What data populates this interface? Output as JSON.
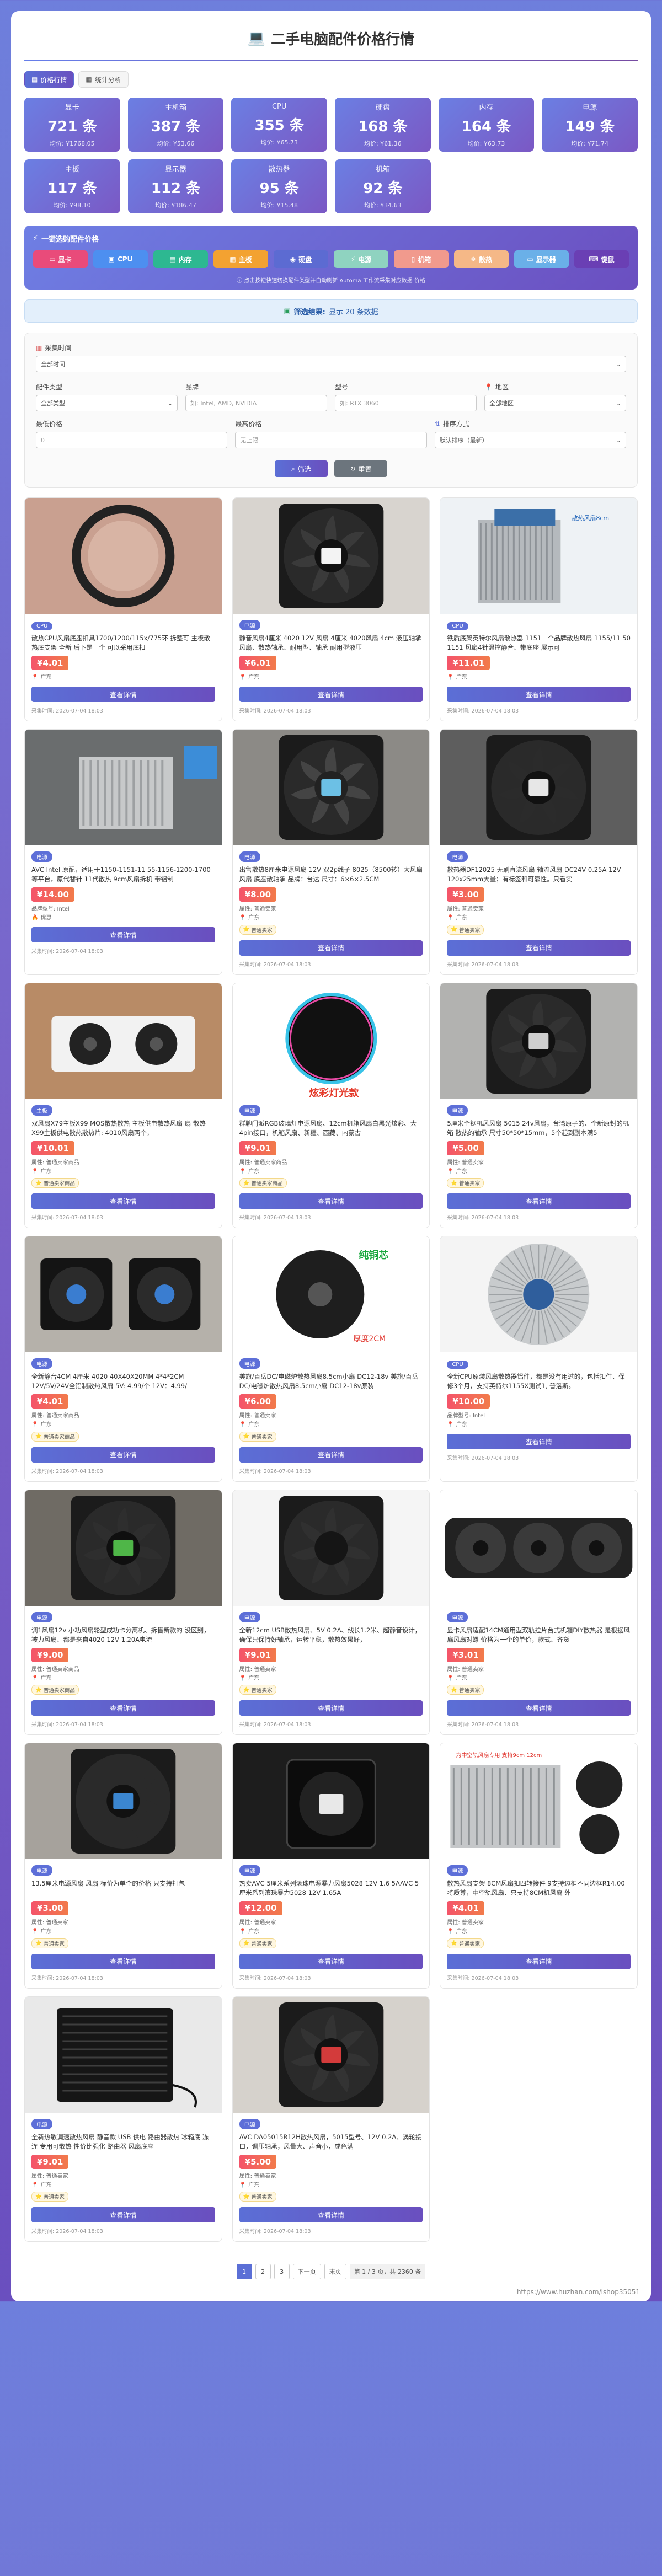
{
  "header": {
    "icon": "monitor-icon",
    "title": "二手电脑配件价格行情"
  },
  "tabs": [
    {
      "label": "价格行情",
      "icon": "price-icon",
      "active": true
    },
    {
      "label": "统计分析",
      "icon": "chart-icon",
      "active": false
    }
  ],
  "stats": [
    {
      "name": "显卡",
      "count": "721 条",
      "avg": "均价: ¥1768.05"
    },
    {
      "name": "主机箱",
      "count": "387 条",
      "avg": "均价: ¥53.66"
    },
    {
      "name": "CPU",
      "count": "355 条",
      "avg": "均价: ¥65.73"
    },
    {
      "name": "硬盘",
      "count": "168 条",
      "avg": "均价: ¥61.36"
    },
    {
      "name": "内存",
      "count": "164 条",
      "avg": "均价: ¥63.73"
    },
    {
      "name": "电源",
      "count": "149 条",
      "avg": "均价: ¥71.74"
    },
    {
      "name": "主板",
      "count": "117 条",
      "avg": "均价: ¥98.10"
    },
    {
      "name": "显示器",
      "count": "112 条",
      "avg": "均价: ¥186.47"
    },
    {
      "name": "散热器",
      "count": "95 条",
      "avg": "均价: ¥15.48"
    },
    {
      "name": "机箱",
      "count": "92 条",
      "avg": "均价: ¥34.63"
    }
  ],
  "quick": {
    "title": "一键选购配件价格",
    "buttons": [
      {
        "label": "显卡",
        "color": "#e94b7a"
      },
      {
        "label": "CPU",
        "color": "#4d8ff0"
      },
      {
        "label": "内存",
        "color": "#2db891"
      },
      {
        "label": "主板",
        "color": "#f3a231"
      },
      {
        "label": "硬盘",
        "color": "#5c6bd2"
      },
      {
        "label": "电源",
        "color": "#8fd3c0"
      },
      {
        "label": "机箱",
        "color": "#f19a8d"
      },
      {
        "label": "散热",
        "color": "#f5b887"
      },
      {
        "label": "显示器",
        "color": "#6ab0e8"
      },
      {
        "label": "键鼠",
        "color": "#6a3fb4"
      }
    ],
    "tip": "点击按钮快速切换配件类型并自动刷新 Automa 工作流采集对应数据 价格"
  },
  "result": {
    "label": "筛选结果:",
    "text": "显示 20 条数据"
  },
  "filters": {
    "category_label": "配件类型",
    "category_value": "全部类型",
    "brand_label": "品牌",
    "brand_placeholder": "如: Intel, AMD, NVIDIA",
    "model_label": "型号",
    "model_placeholder": "如: RTX 3060",
    "region_label": "地区",
    "region_value": "全部地区",
    "time_label": "采集时间",
    "time_value": "全部时间",
    "min_label": "最低价格",
    "min_placeholder": "0",
    "max_label": "最高价格",
    "max_placeholder": "无上限",
    "sort_label": "排序方式",
    "sort_value": "默认排序（最新）",
    "filter_btn": "筛选",
    "reset_btn": "重置"
  },
  "cards": [
    {
      "cat": "CPU",
      "title": "散热CPU风扇底座扣具1700/1200/115x/775环 拆整可 主板散热底支架 全新 后下是一个 可以采用底扣",
      "price": "¥4.01",
      "region": "广东",
      "seller": "",
      "tag": "",
      "date": "采集时间: 2026-07-04 18:03",
      "img": "ring"
    },
    {
      "cat": "电源",
      "title": "静音风扇4厘米 4020 12V 风扇 4厘米 4020风扇 4cm 液压轴承风扇、散热轴承、耐用型、轴承 耐用型液压",
      "price": "¥6.01",
      "region": "广东",
      "seller": "",
      "tag": "",
      "date": "采集时间: 2026-07-04 18:03",
      "img": "fan_dark"
    },
    {
      "cat": "CPU",
      "title": "铁质底架英特尔风扇散热器 1151二个品牌散热风扇 1155/11 50 1151 风扇4针温控静音、带底座 展示可",
      "price": "¥11.01",
      "region": "广东",
      "seller": "",
      "tag": "",
      "date": "采集时间: 2026-07-04 18:03",
      "img": "heatsink_sky"
    },
    {
      "cat": "电源",
      "title": "AVC Intel 原配，适用于1150-1151-11 55-1156-1200-1700等平台，原代替针 11代散热 9cm风扇拆机 带铝制",
      "price": "¥14.00",
      "region": "",
      "seller": "品牌型号: Intel",
      "tag": "",
      "extra": "优惠",
      "date": "采集时间: 2026-07-04 18:03",
      "img": "heatsink_metal"
    },
    {
      "cat": "电源",
      "title": "出售散热8厘米电源风扇 12V 双2p线子 8025（8500转）大风扇风扇 底座散轴承 品牌：台达 尺寸：6×6×2.5CM",
      "price": "¥8.00",
      "region": "广东",
      "seller": "属性: 普通卖家",
      "tag": "普通卖家",
      "date": "采集时间: 2026-07-04 18:03",
      "img": "fan_label"
    },
    {
      "cat": "电源",
      "title": "散热器DF12025 无刷直流风扇 轴流风扇 DC24V 0.25A 12V 120x25mm大量；有标签和可靠性。只看实",
      "price": "¥3.00",
      "region": "广东",
      "seller": "属性: 普通卖家",
      "tag": "普通卖家",
      "date": "采集时间: 2026-07-04 18:03",
      "img": "fan_black_big"
    },
    {
      "cat": "主板",
      "title": "双风扇X79主板X99 MOS散热散热 主板供电散热风扇 扇 散热X99主板供电散热散热片: 4010风扇两个，",
      "price": "¥10.01",
      "region": "广东",
      "seller": "属性: 普通卖家商品",
      "tag": "普通卖家商品",
      "date": "采集时间: 2026-07-04 18:03",
      "img": "x79"
    },
    {
      "cat": "电源",
      "title": "群聊门派RGB玻璃灯电源风扇、12cm机箱风扇白黑光炫彩、大 4pin接口，机箱风扇、新疆、西藏、内蒙古",
      "price": "¥9.01",
      "region": "广东",
      "seller": "属性: 普通卖家商品",
      "tag": "普通卖家商品",
      "date": "采集时间: 2026-07-04 18:03",
      "img": "rgb"
    },
    {
      "cat": "电源",
      "title": "5厘米全钢机风风扇 5015 24v风扇，台湾原子的、全新原封的机箱 散热的轴承 尺寸50*50*15mm，5个起到副本满5",
      "price": "¥5.00",
      "region": "广东",
      "seller": "属性: 普通卖家",
      "tag": "普通卖家",
      "date": "采集时间: 2026-07-04 18:03",
      "img": "fan_5015"
    },
    {
      "cat": "电源",
      "title": "全新静音4CM 4厘米 4020 40X40X20MM 4*4*2CM 12V/5V/24V全铝制散热风扇 5V: 4.99/个 12V：4.99/",
      "price": "¥4.01",
      "region": "广东",
      "seller": "属性: 普通卖家商品",
      "tag": "普通卖家商品",
      "date": "采集时间: 2026-07-04 18:03",
      "img": "fan_stack"
    },
    {
      "cat": "电源",
      "title": "美旗/百岳DC/电磁炉散热风扇8.5cm小扇 DC12-18v 美旗/百岳DC/电磁炉散热风扇8.5cm小扇 DC12-18v原装",
      "price": "¥6.00",
      "region": "广东",
      "seller": "属性: 普通卖家",
      "tag": "普通卖家",
      "date": "采集时间: 2026-07-04 18:03",
      "img": "fan_blade"
    },
    {
      "cat": "CPU",
      "title": "全新CPU原装风扇散热器铝件，都是没有用过的，包括扣件、保修3个月，支持英特尔1155X测试1, 普洛斯。",
      "price": "¥10.00",
      "region": "广东",
      "seller": "品牌型号: Intel",
      "tag": "",
      "date": "采集时间: 2026-07-04 18:03",
      "img": "intel_cooler"
    },
    {
      "cat": "电源",
      "title": "调1风扇12v 小功风扇轮型成功卡分离机、拆售新款的 没区别，  被力风扇、都是来自4020 12V 1.20A电流",
      "price": "¥9.00",
      "region": "广东",
      "seller": "属性: 普通卖家商品",
      "tag": "普通卖家商品",
      "date": "采集时间: 2026-07-04 18:03",
      "img": "fan_green"
    },
    {
      "cat": "电源",
      "title": "全新12cm USB散热风扇、5V 0.2A、线长1.2米、超静音设计，确保只保持好轴承，运转平稳，散热效果好，",
      "price": "¥9.01",
      "region": "广东",
      "seller": "属性: 普通卖家",
      "tag": "普通卖家",
      "date": "采集时间: 2026-07-04 18:03",
      "img": "fan_usb"
    },
    {
      "cat": "电源",
      "title": "显卡风扇适配14CM通用型双轨拉片台式机箱DIY散热器 是根据风扇风扇对螺 价格为一个的单价，款式、齐货",
      "price": "¥3.01",
      "region": "广东",
      "seller": "属性: 普通卖家",
      "tag": "普通卖家",
      "date": "采集时间: 2026-07-04 18:03",
      "img": "gpu_fans"
    },
    {
      "cat": "电源",
      "title": "13.5厘米电源风扇 风扇 标价为单个的价格 只支持打包",
      "price": "¥3.00",
      "region": "广东",
      "seller": "属性: 普通卖家",
      "tag": "普通卖家",
      "date": "采集时间: 2026-07-04 18:03",
      "img": "fan_13"
    },
    {
      "cat": "电源",
      "title": "热卖AVC 5厘米系列滚珠电源暴力风扇5028 12V 1.6 5AAVC 5厘米系列滚珠暴力5028 12V 1.65A",
      "price": "¥12.00",
      "region": "广东",
      "seller": "属性: 普通卖家",
      "tag": "普通卖家",
      "date": "采集时间: 2026-07-04 18:03",
      "img": "fan_avc_cube"
    },
    {
      "cat": "电源",
      "title": "散热风扇支架 8CM风扇扣四转接件 9支持边框不同边框R14.00 将质尊，中空轨风扇、只支持8CM机风扇 外",
      "price": "¥4.01",
      "region": "广东",
      "seller": "属性: 普通卖家",
      "tag": "普通卖家",
      "date": "采集时间: 2026-07-04 18:03",
      "img": "bracket"
    },
    {
      "cat": "电源",
      "title": "全新热敏调速散热风扇 静音款 USB 供电 路由器散热 冰箱底 冻 连 专用可散热 性价比强化 路由器 风扇底座",
      "price": "¥9.01",
      "region": "广东",
      "seller": "属性: 普通卖家",
      "tag": "普通卖家",
      "date": "采集时间: 2026-07-04 18:03",
      "img": "usb_box"
    },
    {
      "cat": "电源",
      "title": "AVC DA05015R12H散热风扇，5015型号、12V 0.2A、涡轮接口，调压轴承，风量大、声音小，成色满",
      "price": "¥5.00",
      "region": "广东",
      "seller": "属性: 普通卖家",
      "tag": "普通卖家",
      "date": "采集时间: 2026-07-04 18:03",
      "img": "fan_avc_red"
    }
  ],
  "card_labels": {
    "detail": "查看详情"
  },
  "pager": {
    "pages": [
      "1",
      "2",
      "3",
      "下一页",
      "末页"
    ],
    "info": "第 1 / 3 页，共 2360 条"
  },
  "watermark": "https://www.huzhan.com/ishop35051"
}
